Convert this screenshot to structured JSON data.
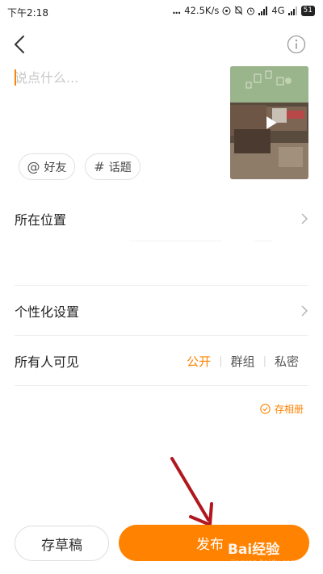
{
  "status_bar": {
    "time": "下午2:18",
    "dots": "...",
    "net_speed": "42.5K/s",
    "network": "4G",
    "battery": "51"
  },
  "compose": {
    "placeholder": "说点什么...",
    "value": ""
  },
  "chips": {
    "friend": {
      "symbol": "@",
      "label": "好友"
    },
    "topic": {
      "symbol": "#",
      "label": "话题"
    }
  },
  "settings": {
    "location_label": "所在位置",
    "personalize_label": "个性化设置",
    "visibility_label": "所有人可见",
    "visibility_options": [
      "公开",
      "群组",
      "私密"
    ],
    "visibility_selected": "公开",
    "separator": "|"
  },
  "save_album_label": "存相册",
  "buttons": {
    "draft_label": "存草稿",
    "publish_label": "发布"
  },
  "watermark": {
    "text": "Bai经验",
    "url": "jingyan.baidu.com"
  },
  "colors": {
    "accent": "#ff8200",
    "annotation_arrow": "#b0171f"
  },
  "icons": {
    "back": "chevron-left-icon",
    "info": "info-circle-icon",
    "play": "play-icon",
    "chevron": "chevron-right-icon",
    "check": "check-circle-icon"
  }
}
